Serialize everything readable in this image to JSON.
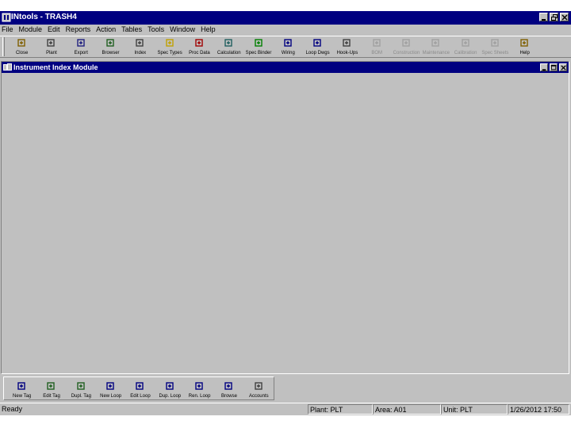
{
  "window": {
    "title": "INtools - TRASH4",
    "controls": [
      "minimize",
      "maximize",
      "close"
    ]
  },
  "menubar": {
    "items": [
      {
        "label": "File"
      },
      {
        "label": "Module"
      },
      {
        "label": "Edit"
      },
      {
        "label": "Reports"
      },
      {
        "label": "Action"
      },
      {
        "label": "Tables"
      },
      {
        "label": "Tools"
      },
      {
        "label": "Window"
      },
      {
        "label": "Help"
      }
    ]
  },
  "toolbar": {
    "buttons": [
      {
        "label": "Close",
        "icon": "close-module-icon",
        "color": "#806000",
        "enabled": true
      },
      {
        "label": "Plant",
        "icon": "plant-icon",
        "color": "#404040",
        "enabled": true
      },
      {
        "label": "Export",
        "icon": "export-icon",
        "color": "#202080",
        "enabled": true
      },
      {
        "label": "Browser",
        "icon": "browser-icon",
        "color": "#206020",
        "enabled": true
      },
      {
        "label": "Index",
        "icon": "index-icon",
        "color": "#404040",
        "enabled": true
      },
      {
        "label": "Spec Types",
        "icon": "spec-types-icon",
        "color": "#c0a000",
        "enabled": true
      },
      {
        "label": "Proc Data",
        "icon": "process-data-icon",
        "color": "#a00000",
        "enabled": true
      },
      {
        "label": "Calculation",
        "icon": "calculation-icon",
        "color": "#206060",
        "enabled": true
      },
      {
        "label": "Spec Binder",
        "icon": "spec-binder-icon",
        "color": "#008000",
        "enabled": true
      },
      {
        "label": "Wiring",
        "icon": "wiring-icon",
        "color": "#000080",
        "enabled": true
      },
      {
        "label": "Loop Dwgs",
        "icon": "loop-drawings-icon",
        "color": "#000080",
        "enabled": true
      },
      {
        "label": "Hook-Ups",
        "icon": "hook-ups-icon",
        "color": "#404040",
        "enabled": true
      },
      {
        "label": "BOM",
        "icon": "bom-icon",
        "color": "#a0a0a0",
        "enabled": false
      },
      {
        "label": "Construction",
        "icon": "construction-icon",
        "color": "#a0a0a0",
        "enabled": false
      },
      {
        "label": "Maintenance",
        "icon": "maintenance-icon",
        "color": "#a0a0a0",
        "enabled": false
      },
      {
        "label": "Calibration",
        "icon": "calibration-icon",
        "color": "#a0a0a0",
        "enabled": false
      },
      {
        "label": "Spec Sheets",
        "icon": "spec-sheets-icon",
        "color": "#a0a0a0",
        "enabled": false
      },
      {
        "label": "Help",
        "icon": "help-icon",
        "color": "#806000",
        "enabled": true
      }
    ]
  },
  "child_window": {
    "title": "Instrument Index Module",
    "controls": [
      "minimize",
      "maximize",
      "close"
    ]
  },
  "bottom_toolbar": {
    "buttons": [
      {
        "label": "New Tag",
        "icon": "new-tag-icon",
        "color": "#000080"
      },
      {
        "label": "Edit Tag",
        "icon": "edit-tag-icon",
        "color": "#206020"
      },
      {
        "label": "Dupl. Tag",
        "icon": "duplicate-tag-icon",
        "color": "#206020"
      },
      {
        "label": "New Loop",
        "icon": "new-loop-icon",
        "color": "#000080"
      },
      {
        "label": "Edit Loop",
        "icon": "edit-loop-icon",
        "color": "#000080"
      },
      {
        "label": "Dup. Loop",
        "icon": "duplicate-loop-icon",
        "color": "#000080"
      },
      {
        "label": "Ren. Loop",
        "icon": "rename-loop-icon",
        "color": "#000080"
      },
      {
        "label": "Browse",
        "icon": "browse-icon",
        "color": "#000080"
      },
      {
        "label": "Accounts",
        "icon": "accounts-icon",
        "color": "#404040"
      }
    ]
  },
  "statusbar": {
    "ready": "Ready",
    "plant": "Plant: PLT",
    "area": "Area: A01",
    "unit": "Unit: PLT",
    "datetime": "1/26/2012 17:50"
  }
}
